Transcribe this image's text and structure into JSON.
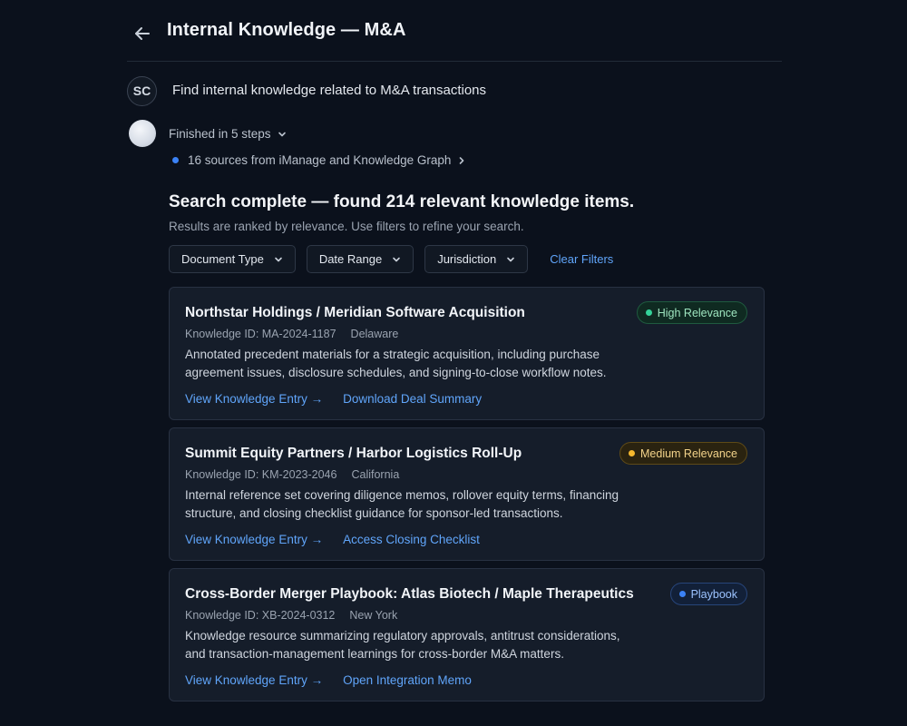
{
  "header": {
    "title": "Internal Knowledge — M&A"
  },
  "user": {
    "initials": "SC",
    "message": "Find internal knowledge related to M&A transactions"
  },
  "assistant": {
    "steps_label": "Finished in 5 steps",
    "sources_label": "16 sources from iManage and Knowledge Graph",
    "result_title": "Search complete — found 214 relevant knowledge items.",
    "result_subtitle": "Results are ranked by relevance. Use filters to refine your search."
  },
  "filters": {
    "document_type": "Document Type",
    "date_range": "Date Range",
    "jurisdiction": "Jurisdiction",
    "clear": "Clear Filters"
  },
  "results": [
    {
      "title": "Northstar Holdings / Meridian Software Acquisition",
      "knowledge_id": "Knowledge ID: MA-2024-1187",
      "jurisdiction": "Delaware",
      "description": "Annotated precedent materials for a strategic acquisition, including purchase agreement issues, disclosure schedules, and signing-to-close workflow notes.",
      "link_primary": "View Knowledge Entry →",
      "link_secondary": "Download Deal Summary",
      "badge": "High Relevance",
      "badge_color": "#34d399"
    },
    {
      "title": "Summit Equity Partners / Harbor Logistics Roll-Up",
      "knowledge_id": "Knowledge ID: KM-2023-2046",
      "jurisdiction": "California",
      "description": "Internal reference set covering diligence memos, rollover equity terms, financing structure, and closing checklist guidance for sponsor-led transactions.",
      "link_primary": "View Knowledge Entry →",
      "link_secondary": "Access Closing Checklist",
      "badge": "Medium Relevance",
      "badge_color": "#f5b82e"
    },
    {
      "title": "Cross-Border Merger Playbook: Atlas Biotech / Maple Therapeutics",
      "knowledge_id": "Knowledge ID: XB-2024-0312",
      "jurisdiction": "New York",
      "description": "Knowledge resource summarizing regulatory approvals, antitrust considerations, and transaction-management learnings for cross-border M&A matters.",
      "link_primary": "View Knowledge Entry →",
      "link_secondary": "Open Integration Memo",
      "badge": "Playbook",
      "badge_color": "#3b82f6"
    }
  ],
  "icons": {
    "back": "arrow-left-icon",
    "chevron_down": "chevron-down-icon",
    "chevron_right": "chevron-right-icon"
  },
  "colors": {
    "background": "#0b111c",
    "card": "#151d2a",
    "link": "#60a5fa"
  }
}
